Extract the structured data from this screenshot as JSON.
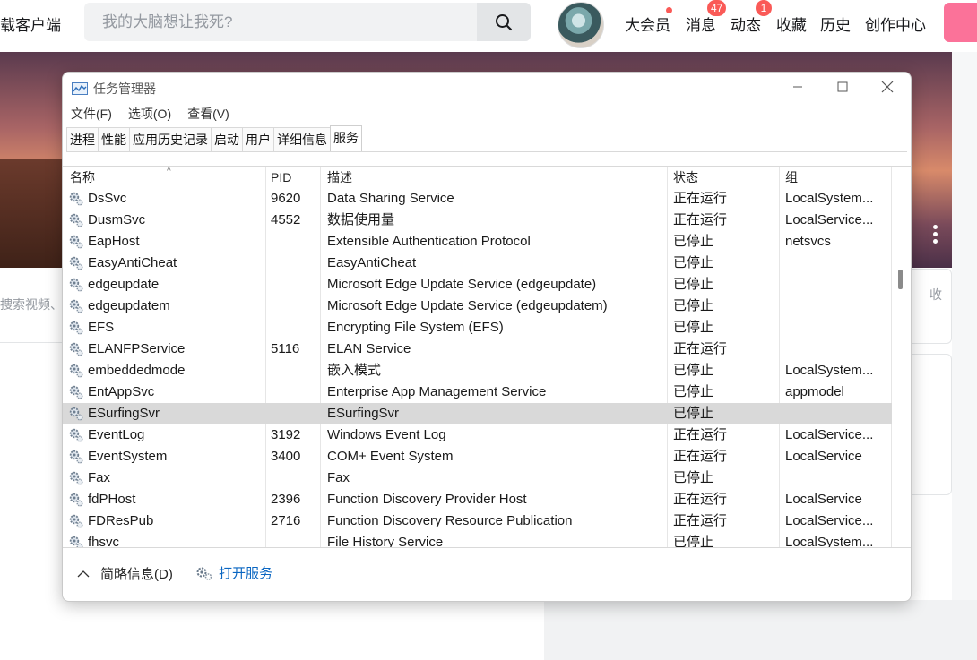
{
  "site": {
    "download_label": "载客户端",
    "search_placeholder": "我的大脑想让我死?",
    "nav": [
      {
        "label": "大会员",
        "badge": ""
      },
      {
        "label": "消息",
        "badge": "47"
      },
      {
        "label": "动态",
        "badge": "1"
      },
      {
        "label": "收藏",
        "badge": ""
      },
      {
        "label": "历史",
        "badge": ""
      },
      {
        "label": "创作中心",
        "badge": ""
      }
    ],
    "side_search_text": "捜索视频、动",
    "right_card_text": "收"
  },
  "task_manager": {
    "title": "任务管理器",
    "menu": [
      "文件(F)",
      "选项(O)",
      "查看(V)"
    ],
    "tabs": [
      "进程",
      "性能",
      "应用历史记录",
      "启动",
      "用户",
      "详细信息",
      "服务"
    ],
    "active_tab": "服务",
    "columns": [
      "名称",
      "PID",
      "描述",
      "状态",
      "组"
    ],
    "rows": [
      {
        "name": "DsSvc",
        "pid": "9620",
        "desc": "Data Sharing Service",
        "status": "正在运行",
        "group": "LocalSystem..."
      },
      {
        "name": "DusmSvc",
        "pid": "4552",
        "desc": "数据使用量",
        "status": "正在运行",
        "group": "LocalService..."
      },
      {
        "name": "EapHost",
        "pid": "",
        "desc": "Extensible Authentication Protocol",
        "status": "已停止",
        "group": "netsvcs"
      },
      {
        "name": "EasyAntiCheat",
        "pid": "",
        "desc": "EasyAntiCheat",
        "status": "已停止",
        "group": ""
      },
      {
        "name": "edgeupdate",
        "pid": "",
        "desc": "Microsoft Edge Update Service (edgeupdate)",
        "status": "已停止",
        "group": ""
      },
      {
        "name": "edgeupdatem",
        "pid": "",
        "desc": "Microsoft Edge Update Service (edgeupdatem)",
        "status": "已停止",
        "group": ""
      },
      {
        "name": "EFS",
        "pid": "",
        "desc": "Encrypting File System (EFS)",
        "status": "已停止",
        "group": ""
      },
      {
        "name": "ELANFPService",
        "pid": "5116",
        "desc": "ELAN Service",
        "status": "正在运行",
        "group": ""
      },
      {
        "name": "embeddedmode",
        "pid": "",
        "desc": "嵌入模式",
        "status": "已停止",
        "group": "LocalSystem..."
      },
      {
        "name": "EntAppSvc",
        "pid": "",
        "desc": "Enterprise App Management Service",
        "status": "已停止",
        "group": "appmodel"
      },
      {
        "name": "ESurfingSvr",
        "pid": "",
        "desc": "ESurfingSvr",
        "status": "已停止",
        "group": "",
        "selected": true
      },
      {
        "name": "EventLog",
        "pid": "3192",
        "desc": "Windows Event Log",
        "status": "正在运行",
        "group": "LocalService..."
      },
      {
        "name": "EventSystem",
        "pid": "3400",
        "desc": "COM+ Event System",
        "status": "正在运行",
        "group": "LocalService"
      },
      {
        "name": "Fax",
        "pid": "",
        "desc": "Fax",
        "status": "已停止",
        "group": ""
      },
      {
        "name": "fdPHost",
        "pid": "2396",
        "desc": "Function Discovery Provider Host",
        "status": "正在运行",
        "group": "LocalService"
      },
      {
        "name": "FDResPub",
        "pid": "2716",
        "desc": "Function Discovery Resource Publication",
        "status": "正在运行",
        "group": "LocalService..."
      },
      {
        "name": "fhsvc",
        "pid": "",
        "desc": "File History Service",
        "status": "已停止",
        "group": "LocalSystem..."
      }
    ],
    "footer": {
      "brief_label": "简略信息(D)",
      "open_services_label": "打开服务"
    }
  }
}
